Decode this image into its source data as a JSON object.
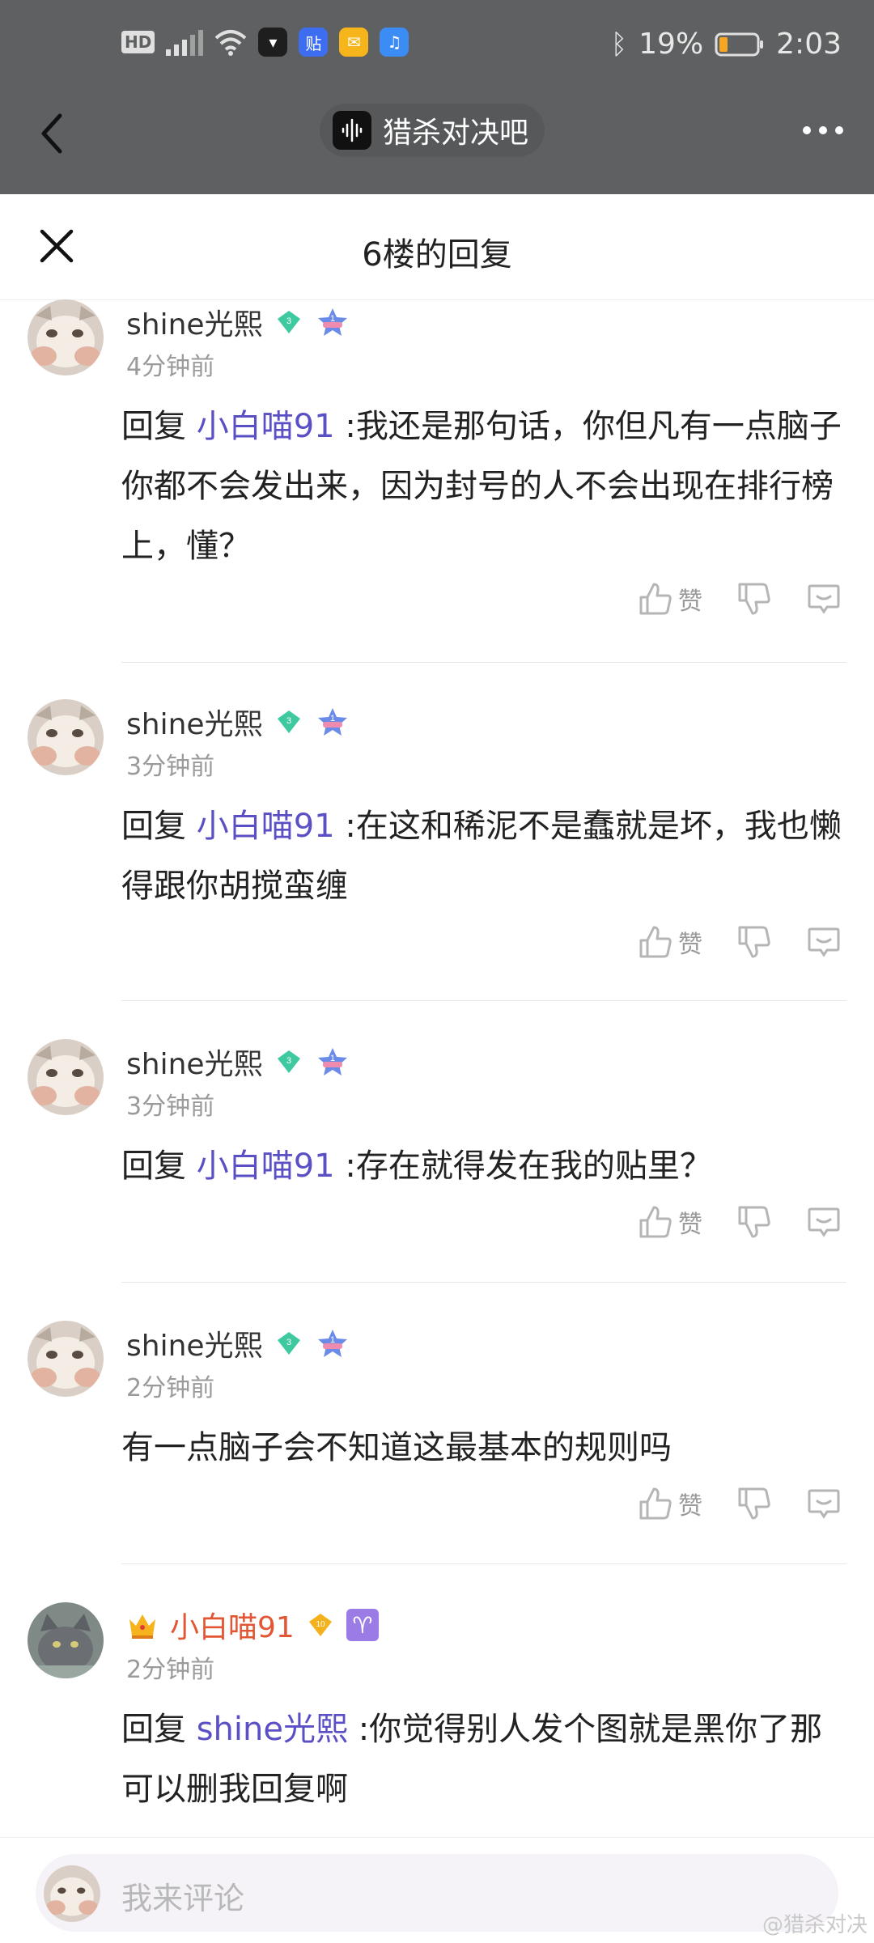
{
  "status_bar": {
    "battery": "19%",
    "time": "2:03"
  },
  "header": {
    "forum_name": "猎杀对决吧"
  },
  "sheet": {
    "title": "6楼的回复"
  },
  "comments": [
    {
      "user": "shine光熙",
      "level": "3",
      "time": "4分钟前",
      "reply_prefix": "回复",
      "reply_to": "小白喵91",
      "text": ":我还是那句话，你但凡有一点脑子你都不会发出来，因为封号的人不会出现在排行榜上，懂？",
      "like_label": "赞"
    },
    {
      "user": "shine光熙",
      "level": "3",
      "time": "3分钟前",
      "reply_prefix": "回复",
      "reply_to": "小白喵91",
      "text": ":在这和稀泥不是蠢就是坏，我也懒得跟你胡搅蛮缠",
      "like_label": "赞"
    },
    {
      "user": "shine光熙",
      "level": "3",
      "time": "3分钟前",
      "reply_prefix": "回复",
      "reply_to": "小白喵91",
      "text": ":存在就得发在我的贴里？",
      "like_label": "赞"
    },
    {
      "user": "shine光熙",
      "level": "3",
      "time": "2分钟前",
      "text": "有一点脑子会不知道这最基本的规则吗",
      "like_label": "赞"
    },
    {
      "user": "小白喵91",
      "level": "10",
      "time": "2分钟前",
      "zodiac": "♈",
      "reply_prefix": "回复",
      "reply_to": "shine光熙",
      "text": ":你觉得别人发个图就是黑你了那可以删我回复啊"
    }
  ],
  "bottom_bar": {
    "placeholder": "我来评论",
    "watermark": "@猎杀对决"
  }
}
